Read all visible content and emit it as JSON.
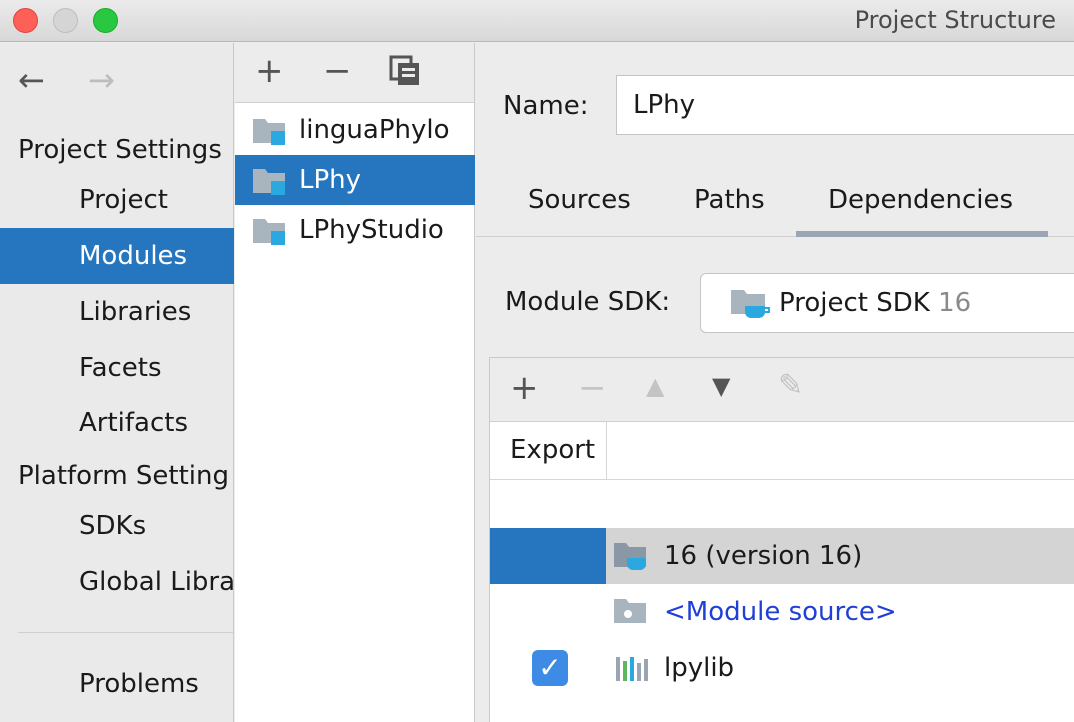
{
  "window": {
    "title": "Project Structure"
  },
  "nav": {
    "back": "←",
    "forward": "→"
  },
  "sidebar": {
    "project_settings": "Project Settings",
    "platform_settings": "Platform Setting",
    "items": [
      {
        "label": "Project"
      },
      {
        "label": "Modules",
        "selected": true
      },
      {
        "label": "Libraries"
      },
      {
        "label": "Facets"
      },
      {
        "label": "Artifacts"
      },
      {
        "label": "SDKs"
      },
      {
        "label": "Global Libra"
      },
      {
        "label": "Problems"
      }
    ]
  },
  "modules_toolbar": {
    "add": "+",
    "remove": "−",
    "copy": "⧉"
  },
  "modules": [
    {
      "label": "linguaPhylo"
    },
    {
      "label": "LPhy",
      "selected": true
    },
    {
      "label": "LPhyStudio"
    }
  ],
  "main": {
    "name_label": "Name:",
    "name_value": "LPhy",
    "tabs": [
      {
        "label": "Sources"
      },
      {
        "label": "Paths"
      },
      {
        "label": "Dependencies",
        "active": true
      }
    ],
    "sdk_label": "Module SDK:",
    "sdk_value": "Project SDK",
    "sdk_version": "16"
  },
  "deps_toolbar": {
    "add": "+",
    "remove": "−",
    "up": "▲",
    "down": "▼",
    "edit": "✎"
  },
  "deps": {
    "export_header": "Export",
    "rows": [
      {
        "label": "16 (version 16)",
        "selected": true,
        "export": false
      },
      {
        "label": "<Module source>",
        "export": false
      },
      {
        "label": "lpylib",
        "export": true
      }
    ]
  },
  "colors": {
    "selection": "#2675bf",
    "link": "#1f3fd6",
    "checkbox": "#3d8be5"
  }
}
